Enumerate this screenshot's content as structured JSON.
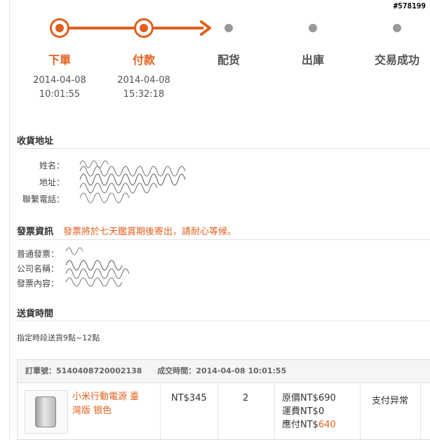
{
  "watermark": "#578199",
  "progress": {
    "steps": [
      {
        "label": "下單",
        "date": "2014-04-08",
        "time": "10:01:55",
        "state": "done"
      },
      {
        "label": "付款",
        "date": "2014-04-08",
        "time": "15:32:18",
        "state": "done"
      },
      {
        "label": "配货",
        "state": "pending"
      },
      {
        "label": "出庫",
        "state": "pending"
      },
      {
        "label": "交易成功",
        "state": "pending"
      }
    ]
  },
  "shipping_address": {
    "title": "收貨地址",
    "labels": [
      "姓名：",
      "地址：",
      "聯繫電話："
    ]
  },
  "invoice": {
    "title": "發票資訊",
    "notice": "發票將於七天鑑賞期後寄出，請耐心等候。",
    "labels": [
      "普通發票：",
      "公司名稱：",
      "發票內容："
    ]
  },
  "delivery": {
    "title": "送貨時間",
    "text": "指定時段送貨9點~12點"
  },
  "order": {
    "number_label": "訂單號：",
    "number": "5140408720002138",
    "time_label": "成交時間：",
    "time": "2014-04-08 10:01:55",
    "product_name": "小米行動電源 臺灣版 银色",
    "price": "NT$345",
    "quantity": "2",
    "original_label": "原價",
    "original": "NT$690",
    "shipping_label": "運費",
    "shipping": "NT$0",
    "payable_label": "應付NT$",
    "payable": "640",
    "status": "支付异常"
  },
  "colors": {
    "accent": "#e0601e",
    "pending": "#999999"
  }
}
